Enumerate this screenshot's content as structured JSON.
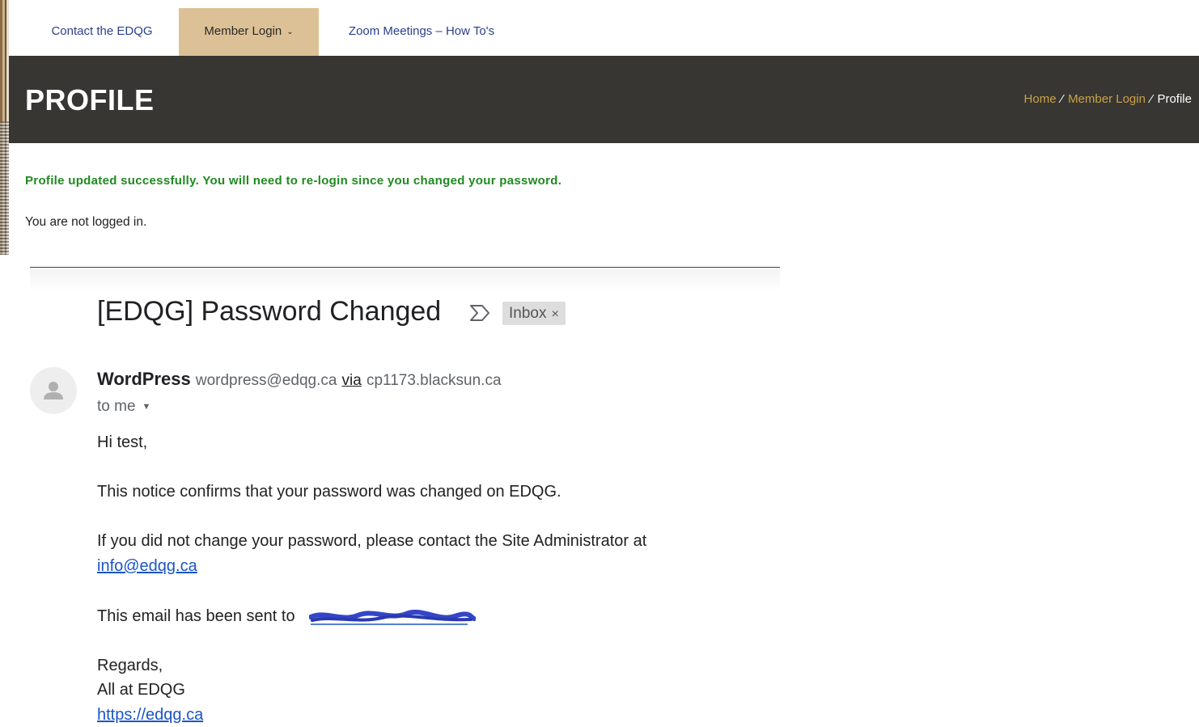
{
  "nav": {
    "contact": "Contact the EDQG",
    "member_login": "Member Login",
    "zoom": "Zoom Meetings – How To's"
  },
  "header": {
    "title": "PROFILE",
    "breadcrumb": [
      "Home",
      "Member Login",
      "Profile"
    ]
  },
  "messages": {
    "success": "Profile updated successfully. You will need to re-login since you changed your password.",
    "status": "You are not logged in."
  },
  "email": {
    "subject": "[EDQG] Password Changed",
    "label": "Inbox",
    "sender_name": "WordPress",
    "sender_email": "wordpress@edqg.ca",
    "via": "via",
    "via_host": "cp1173.blacksun.ca",
    "to": "to me",
    "greeting": "Hi test,",
    "line1": "This notice confirms that your password was changed on EDQG.",
    "line2": "If you did not change your password, please contact the Site Administrator at",
    "admin_email": "info@edqg.ca",
    "line3": "This email has been sent to",
    "regards": "Regards,",
    "signoff": "All at EDQG",
    "site_url": "https://edqg.ca"
  },
  "colors": {
    "nav_active_bg": "#dcc196",
    "header_bg": "#383632",
    "breadcrumb_link": "#c9a24a",
    "success_green": "#1f8a1f",
    "link_blue": "#1a55c4"
  }
}
